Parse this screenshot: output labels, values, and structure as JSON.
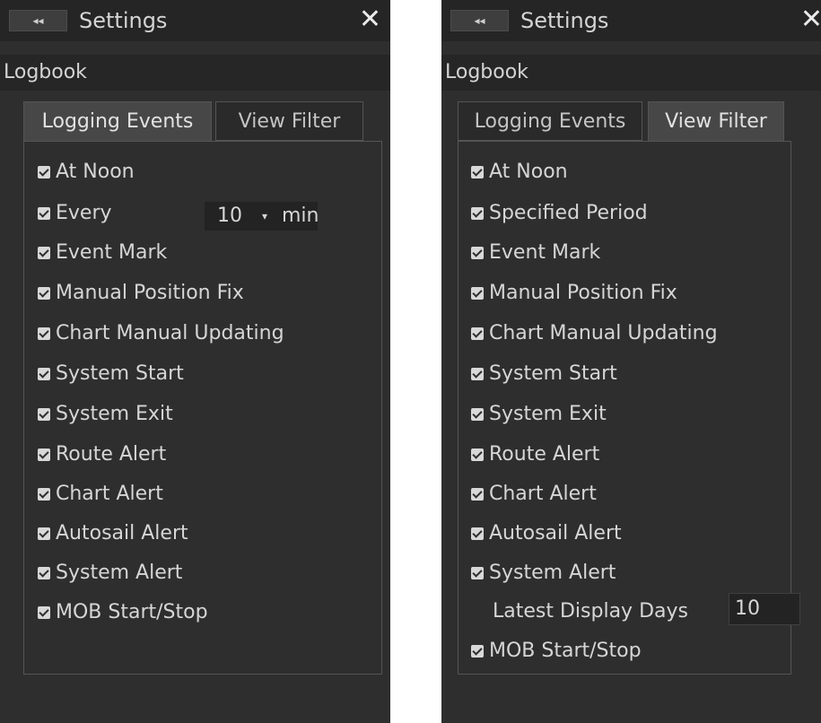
{
  "panels": [
    {
      "back_label": "◂◂",
      "title": "Settings",
      "close_label": "✕",
      "section": "Logbook",
      "tabs": [
        "Logging Events",
        "View Filter"
      ],
      "active_tab": "Logging Events",
      "interval": {
        "label": "Every",
        "value": "10",
        "unit": "min"
      },
      "items": [
        {
          "label": "At Noon",
          "checked": true
        },
        {
          "label": "Every",
          "checked": true
        },
        {
          "label": "Event Mark",
          "checked": true
        },
        {
          "label": "Manual Position Fix",
          "checked": true
        },
        {
          "label": "Chart Manual Updating",
          "checked": true
        },
        {
          "label": "System Start",
          "checked": true
        },
        {
          "label": "System Exit",
          "checked": true
        },
        {
          "label": "Route Alert",
          "checked": true
        },
        {
          "label": "Chart Alert",
          "checked": true
        },
        {
          "label": "Autosail Alert",
          "checked": true
        },
        {
          "label": "System Alert",
          "checked": true
        },
        {
          "label": "MOB Start/Stop",
          "checked": true
        }
      ]
    },
    {
      "back_label": "◂◂",
      "title": "Settings",
      "close_label": "✕",
      "section": "Logbook",
      "tabs": [
        "Logging Events",
        "View Filter"
      ],
      "active_tab": "View Filter",
      "items": [
        {
          "label": "At Noon",
          "checked": true
        },
        {
          "label": "Specified Period",
          "checked": true
        },
        {
          "label": "Event Mark",
          "checked": true
        },
        {
          "label": "Manual Position Fix",
          "checked": true
        },
        {
          "label": "Chart Manual Updating",
          "checked": true
        },
        {
          "label": "System Start",
          "checked": true
        },
        {
          "label": "System Exit",
          "checked": true
        },
        {
          "label": "Route Alert",
          "checked": true
        },
        {
          "label": "Chart Alert",
          "checked": true
        },
        {
          "label": "Autosail Alert",
          "checked": true
        },
        {
          "label": "System Alert",
          "checked": true
        },
        {
          "label": "MOB Start/Stop",
          "checked": true
        }
      ],
      "latest_display_days": {
        "label": "Latest Display Days",
        "value": "10"
      }
    }
  ]
}
